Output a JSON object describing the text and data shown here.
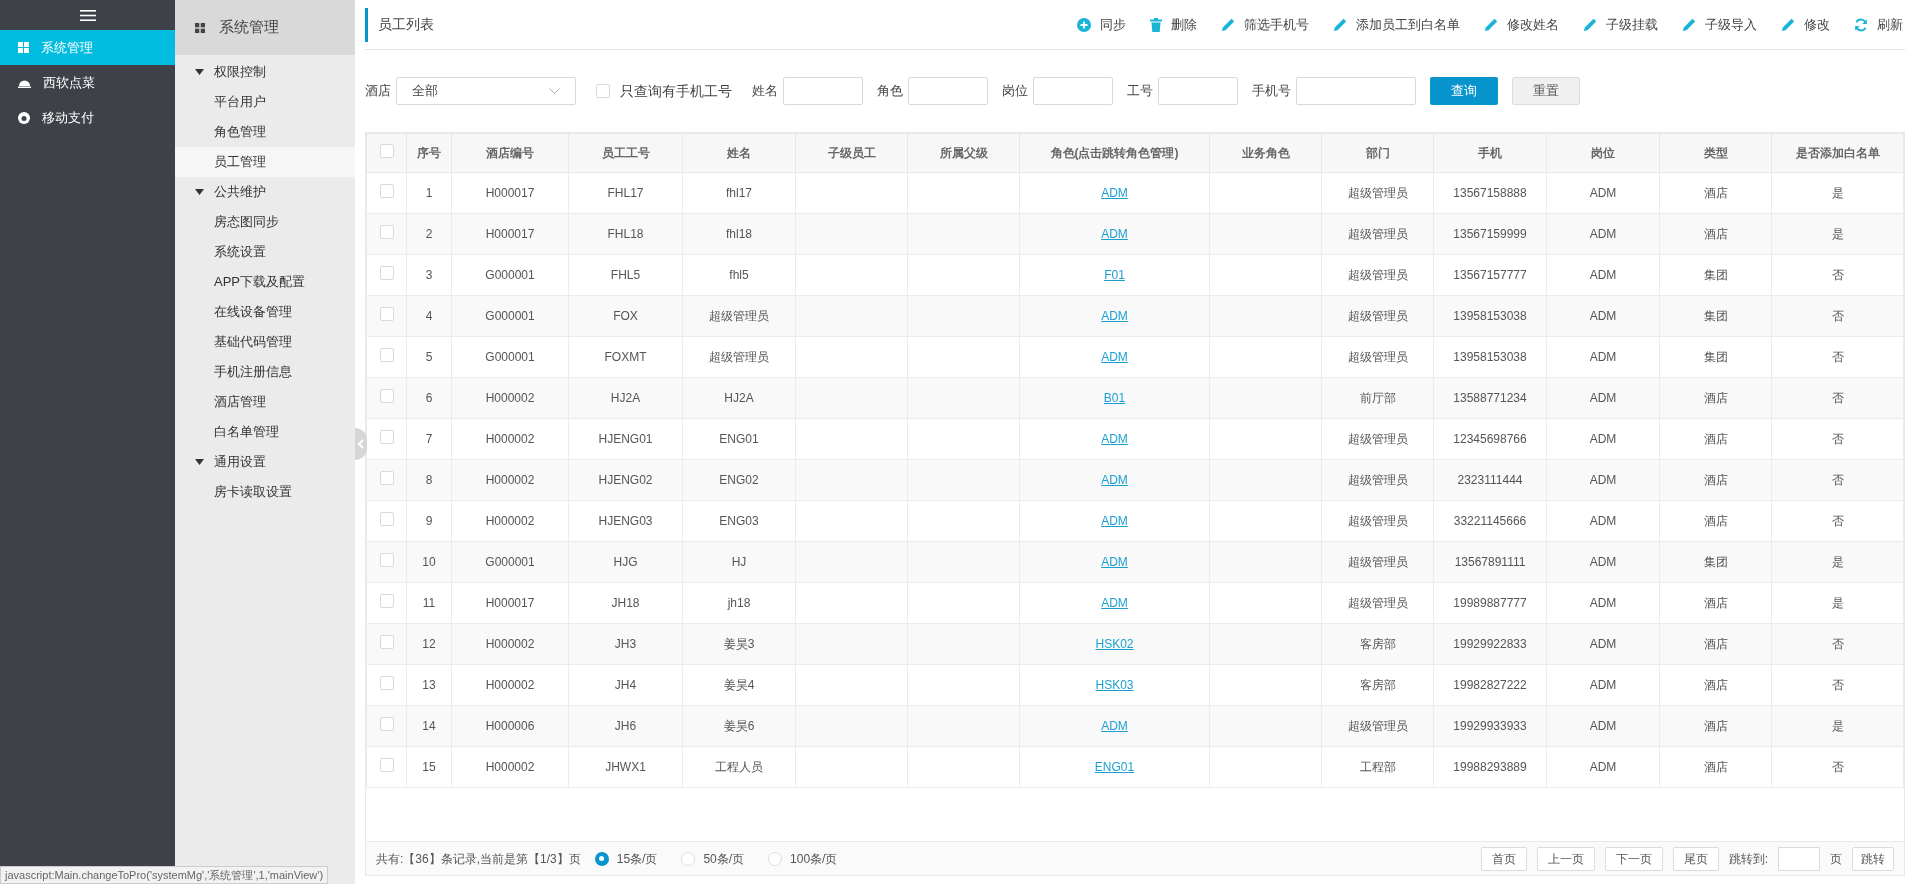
{
  "nav": {
    "items": [
      {
        "label": "系统管理",
        "selected": true
      },
      {
        "label": "西软点菜",
        "selected": false
      },
      {
        "label": "移动支付",
        "selected": false
      }
    ]
  },
  "submenu": {
    "title": "系统管理",
    "groups": [
      {
        "label": "权限控制",
        "expanded": true,
        "children": [
          {
            "label": "平台用户",
            "selected": false
          },
          {
            "label": "角色管理",
            "selected": false
          },
          {
            "label": "员工管理",
            "selected": true
          }
        ]
      },
      {
        "label": "公共维护",
        "expanded": true,
        "children": [
          {
            "label": "房态图同步",
            "selected": false
          },
          {
            "label": "系统设置",
            "selected": false
          },
          {
            "label": "APP下载及配置",
            "selected": false
          },
          {
            "label": "在线设备管理",
            "selected": false
          },
          {
            "label": "基础代码管理",
            "selected": false
          },
          {
            "label": "手机注册信息",
            "selected": false
          },
          {
            "label": "酒店管理",
            "selected": false
          },
          {
            "label": "白名单管理",
            "selected": false
          }
        ]
      },
      {
        "label": "通用设置",
        "expanded": true,
        "children": [
          {
            "label": "房卡读取设置",
            "selected": false
          }
        ]
      }
    ]
  },
  "page_title": "员工列表",
  "toolbar": [
    {
      "kind": "plus",
      "label": "同步"
    },
    {
      "kind": "trash",
      "label": "删除"
    },
    {
      "kind": "pencil",
      "label": "筛选手机号"
    },
    {
      "kind": "pencil",
      "label": "添加员工到白名单"
    },
    {
      "kind": "pencil",
      "label": "修改姓名"
    },
    {
      "kind": "pencil",
      "label": "子级挂载"
    },
    {
      "kind": "pencil",
      "label": "子级导入"
    },
    {
      "kind": "pencil",
      "label": "修改"
    },
    {
      "kind": "refresh",
      "label": "刷新"
    }
  ],
  "filters": {
    "hotel_label": "酒店",
    "hotel_value": "全部",
    "phone_only": {
      "label": "只查询有手机工号",
      "checked": false
    },
    "fields": [
      {
        "label": "姓名"
      },
      {
        "label": "角色"
      },
      {
        "label": "岗位"
      },
      {
        "label": "工号"
      },
      {
        "label": "手机号"
      }
    ],
    "search_button": "查询",
    "reset_button": "重置"
  },
  "table": {
    "all_checked": false,
    "columns": [
      "序号",
      "酒店编号",
      "员工工号",
      "姓名",
      "子级员工",
      "所属父级",
      "角色(点击跳转角色管理)",
      "业务角色",
      "部门",
      "手机",
      "岗位",
      "类型",
      "是否添加白名单"
    ],
    "rows": [
      {
        "checked": false,
        "no": "1",
        "hotel": "H000017",
        "staff": "FHL17",
        "name": "fhl17",
        "role": "ADM",
        "dept": "超级管理员",
        "phone": "13567158888",
        "post": "ADM",
        "type": "酒店",
        "whitelist": "是"
      },
      {
        "checked": false,
        "no": "2",
        "hotel": "H000017",
        "staff": "FHL18",
        "name": "fhl18",
        "role": "ADM",
        "dept": "超级管理员",
        "phone": "13567159999",
        "post": "ADM",
        "type": "酒店",
        "whitelist": "是"
      },
      {
        "checked": false,
        "no": "3",
        "hotel": "G000001",
        "staff": "FHL5",
        "name": "fhl5",
        "role": "F01",
        "dept": "超级管理员",
        "phone": "13567157777",
        "post": "ADM",
        "type": "集团",
        "whitelist": "否"
      },
      {
        "checked": false,
        "no": "4",
        "hotel": "G000001",
        "staff": "FOX",
        "name": "超级管理员",
        "role": "ADM",
        "dept": "超级管理员",
        "phone": "13958153038",
        "post": "ADM",
        "type": "集团",
        "whitelist": "否"
      },
      {
        "checked": false,
        "no": "5",
        "hotel": "G000001",
        "staff": "FOXMT",
        "name": "超级管理员",
        "role": "ADM",
        "dept": "超级管理员",
        "phone": "13958153038",
        "post": "ADM",
        "type": "集团",
        "whitelist": "否"
      },
      {
        "checked": false,
        "no": "6",
        "hotel": "H000002",
        "staff": "HJ2A",
        "name": "HJ2A",
        "role": "B01",
        "dept": "前厅部",
        "phone": "13588771234",
        "post": "ADM",
        "type": "酒店",
        "whitelist": "否"
      },
      {
        "checked": false,
        "no": "7",
        "hotel": "H000002",
        "staff": "HJENG01",
        "name": "ENG01",
        "role": "ADM",
        "dept": "超级管理员",
        "phone": "12345698766",
        "post": "ADM",
        "type": "酒店",
        "whitelist": "否"
      },
      {
        "checked": false,
        "no": "8",
        "hotel": "H000002",
        "staff": "HJENG02",
        "name": "ENG02",
        "role": "ADM",
        "dept": "超级管理员",
        "phone": "2323111444",
        "post": "ADM",
        "type": "酒店",
        "whitelist": "否"
      },
      {
        "checked": false,
        "no": "9",
        "hotel": "H000002",
        "staff": "HJENG03",
        "name": "ENG03",
        "role": "ADM",
        "dept": "超级管理员",
        "phone": "33221145666",
        "post": "ADM",
        "type": "酒店",
        "whitelist": "否"
      },
      {
        "checked": false,
        "no": "10",
        "hotel": "G000001",
        "staff": "HJG",
        "name": "HJ",
        "role": "ADM",
        "dept": "超级管理员",
        "phone": "13567891111",
        "post": "ADM",
        "type": "集团",
        "whitelist": "是"
      },
      {
        "checked": false,
        "no": "11",
        "hotel": "H000017",
        "staff": "JH18",
        "name": "jh18",
        "role": "ADM",
        "dept": "超级管理员",
        "phone": "19989887777",
        "post": "ADM",
        "type": "酒店",
        "whitelist": "是"
      },
      {
        "checked": false,
        "no": "12",
        "hotel": "H000002",
        "staff": "JH3",
        "name": "姜昊3",
        "role": "HSK02",
        "dept": "客房部",
        "phone": "19929922833",
        "post": "ADM",
        "type": "酒店",
        "whitelist": "否"
      },
      {
        "checked": false,
        "no": "13",
        "hotel": "H000002",
        "staff": "JH4",
        "name": "姜昊4",
        "role": "HSK03",
        "dept": "客房部",
        "phone": "19982827222",
        "post": "ADM",
        "type": "酒店",
        "whitelist": "否"
      },
      {
        "checked": false,
        "no": "14",
        "hotel": "H000006",
        "staff": "JH6",
        "name": "姜昊6",
        "role": "ADM",
        "dept": "超级管理员",
        "phone": "19929933933",
        "post": "ADM",
        "type": "酒店",
        "whitelist": "是"
      },
      {
        "checked": false,
        "no": "15",
        "hotel": "H000002",
        "staff": "JHWX1",
        "name": "工程人员",
        "role": "ENG01",
        "dept": "工程部",
        "phone": "19988293889",
        "post": "ADM",
        "type": "酒店",
        "whitelist": "否"
      }
    ]
  },
  "pager": {
    "summary": "共有:【36】条记录,当前是第【1/3】页",
    "sizes": [
      {
        "label": "15条/页",
        "selected": true
      },
      {
        "label": "50条/页",
        "selected": false
      },
      {
        "label": "100条/页",
        "selected": false
      }
    ],
    "buttons": [
      "首页",
      "上一页",
      "下一页",
      "尾页"
    ],
    "jump_label": "跳转到:",
    "page_unit": "页",
    "jump_button": "跳转"
  },
  "status_bar": "javascript:Main.changeToPro('systemMg','系统管理',1,'mainView')"
}
